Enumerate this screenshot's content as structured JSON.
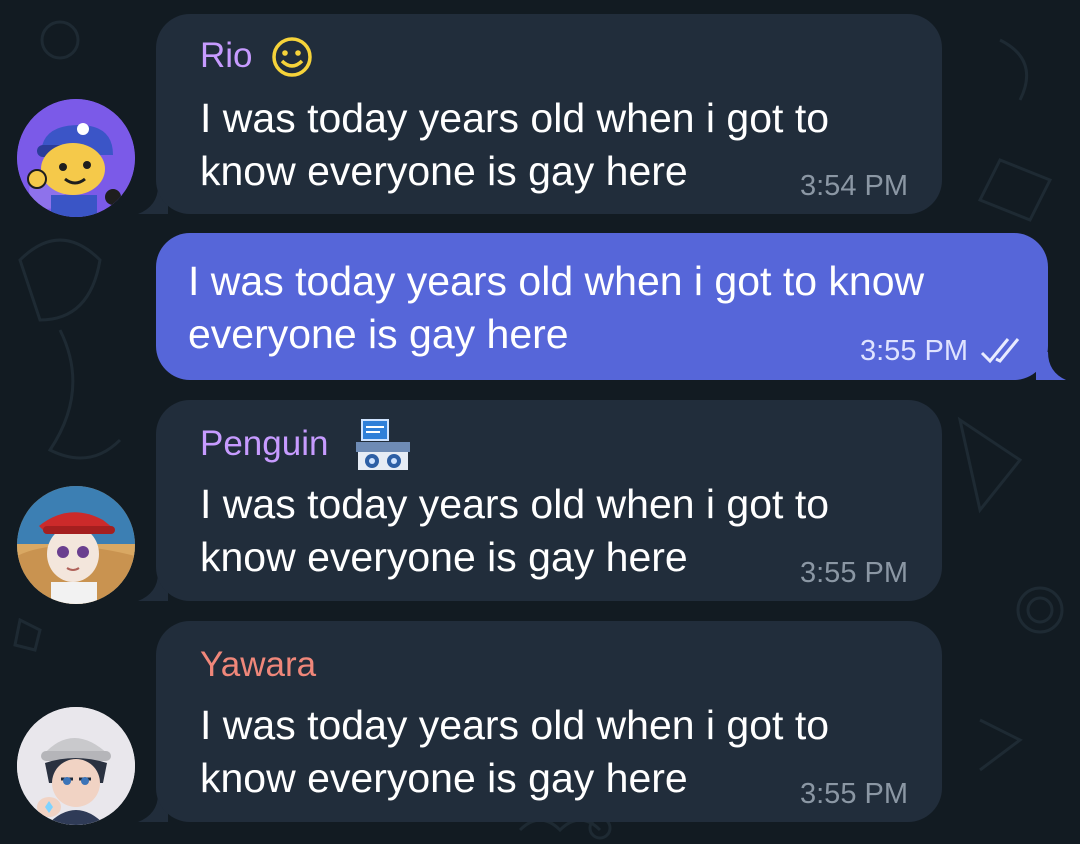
{
  "messages": [
    {
      "sender": "Rio",
      "text_line1": "I was today years old when i got to",
      "text_line2": "know everyone is gay here",
      "time": "3:54 PM",
      "sender_color": "#c79bff",
      "status_icon": "smiley-face-emoji"
    },
    {
      "outgoing": true,
      "text_line1": "I was today years old when i got to know",
      "text_line2": "everyone is gay here",
      "time": "3:55 PM",
      "status_icon": "double-check-icon"
    },
    {
      "sender": "Penguin",
      "text_line1": "I was today years old when i got to",
      "text_line2": "know everyone is gay here",
      "time": "3:55 PM",
      "sender_color": "#c79bff",
      "status_icon": "computer-machine-emoji"
    },
    {
      "sender": "Yawara",
      "text_line1": "I was today years old when i got to",
      "text_line2": "know everyone is gay here",
      "time": "3:55 PM",
      "sender_color": "#f0877a"
    }
  ],
  "colors": {
    "background": "#121b22",
    "incoming_bubble": "#212d3b",
    "outgoing_bubble": "#5666d9"
  }
}
